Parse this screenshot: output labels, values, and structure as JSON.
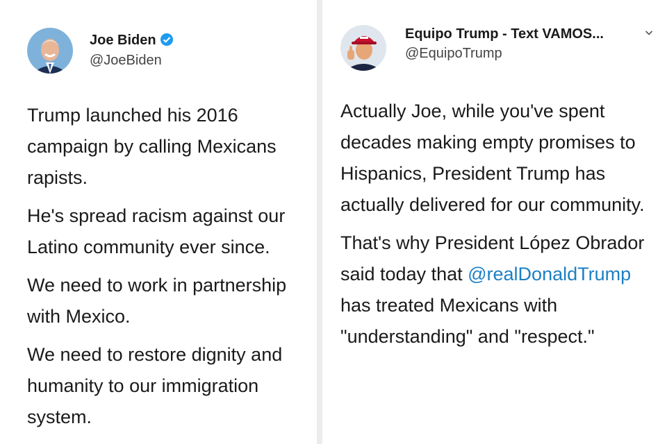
{
  "left_tweet": {
    "author_name": "Joe Biden",
    "author_handle": "@JoeBiden",
    "verified_icon": "verified-badge-icon",
    "paragraphs": [
      "Trump launched his 2016 campaign by calling Mexicans rapists.",
      "He's spread racism against our Latino community ever since.",
      "We need to work in partnership with Mexico.",
      "We need to restore dignity and humanity to our immigration system."
    ]
  },
  "right_tweet": {
    "author_name": "Equipo Trump - Text VAMOS...",
    "author_handle": "@EquipoTrump",
    "menu_icon": "chevron-down-icon",
    "paragraph_1": "Actually Joe, while you've spent decades making empty promises to Hispanics, President Trump has actually delivered for our community.",
    "paragraph_2_before": "That's why President López Obrador said today that ",
    "paragraph_2_mention": "@realDonaldTrump",
    "paragraph_2_after": " has treated Mexicans with \"understanding\" and \"respect.\""
  },
  "colors": {
    "verified_blue": "#1d9bf0",
    "mention_blue": "#1d7fc4",
    "divider_gray": "#ececec"
  }
}
